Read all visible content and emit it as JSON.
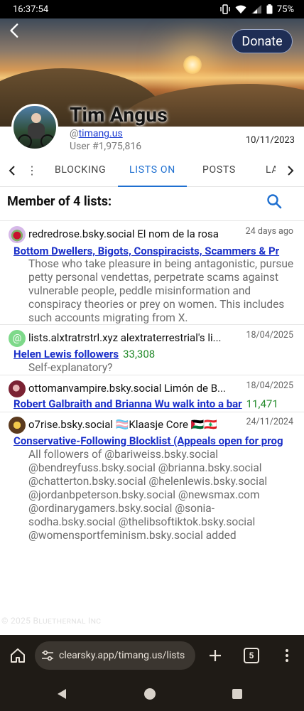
{
  "status_bar": {
    "time": "16:37:54",
    "battery": "75%"
  },
  "header": {
    "donate_label": "Donate"
  },
  "profile": {
    "display_name": "Tim Angus",
    "handle_prefix": "@",
    "handle": "timang.us",
    "user_number": "User #1,975,816",
    "date": "10/11/2023"
  },
  "tabs": {
    "items": [
      {
        "label": "BLOCKING"
      },
      {
        "label": "LISTS ON"
      },
      {
        "label": "POSTS"
      },
      {
        "label": "LA"
      }
    ],
    "active": "LISTS ON"
  },
  "section": {
    "title": "Member of 4 lists:"
  },
  "entries": [
    {
      "owner": "redredrose.bsky.social El nom de la rosa",
      "date": "24 days ago",
      "list_name": "Bottom Dwellers, Bigots, Conspiracists, Scammers & Pr",
      "count": "",
      "description": "Those who take pleasure in being antagonistic, pursue petty personal vendettas, perpetrate scams against vulnerable people, peddle misinformation and conspiracy theories or prey on women. This includes such accounts migrating from X."
    },
    {
      "owner": "lists.alxtratrstrl.xyz alextraterrestrial's li...",
      "date": "18/04/2025",
      "list_name": "Helen Lewis followers",
      "count": "33,308",
      "description": "Self-explanatory?"
    },
    {
      "owner": "ottomanvampire.bsky.social Limón de B...",
      "date": "18/04/2025",
      "list_name": "Robert Galbraith and Brianna Wu walk into a bar",
      "count": "11,471",
      "description": ""
    },
    {
      "owner": "o7rise.bsky.social 🏳️‍⚧️Klaasje Core 🇵🇸🇱🇧",
      "date": "24/11/2024",
      "list_name": "Conservative-Following Blocklist (Appeals open for prog",
      "count": "",
      "description": "All followers of @bariweiss.bsky.social @bendreyfuss.bsky.social @brianna.bsky.social @chatterton.bsky.social @helenlewis.bsky.social @jordanbpeterson.bsky.social @newsmax.com @ordinarygamers.bsky.social @sonia-sodha.bsky.social @thelibsoftiktok.bsky.social @womensportfeminism.bsky.social added"
    }
  ],
  "footer": {
    "text": "© 2025 Bluethernal Inc"
  },
  "browser": {
    "url": "clearsky.app/timang.us/lists",
    "tab_count": "5"
  },
  "colors": {
    "link": "#1a2fc9",
    "count": "#238a2a",
    "accent": "#1e6fd0",
    "donate_bg": "#1f2e55"
  }
}
